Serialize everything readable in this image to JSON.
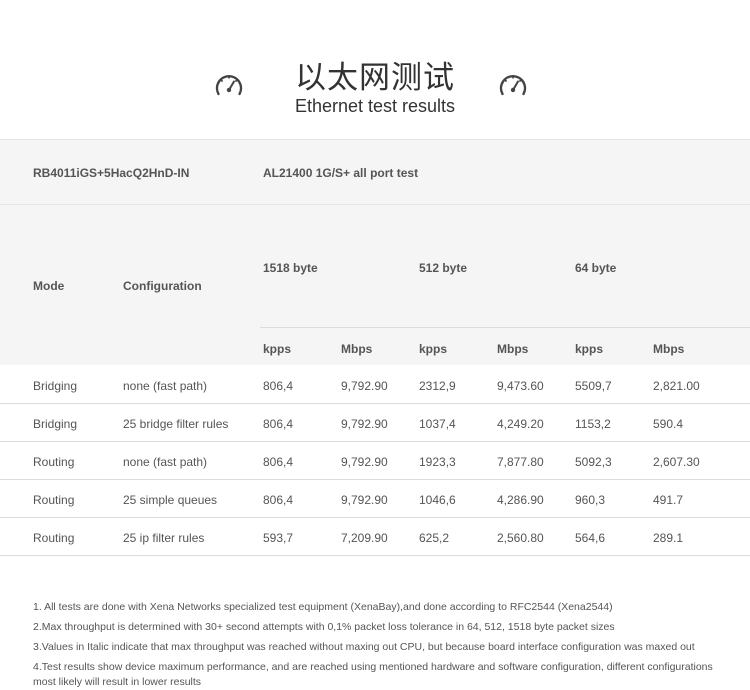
{
  "header": {
    "title_cn": "以太网测试",
    "title_en": "Ethernet test results"
  },
  "table": {
    "device": "RB4011iGS+5HacQ2HnD-IN",
    "test_name": "AL21400 1G/S+ all port test",
    "col_mode": "Mode",
    "col_configuration": "Configuration",
    "packet_sizes": [
      "1518 byte",
      "512 byte",
      "64 byte"
    ],
    "units": [
      "kpps",
      "Mbps",
      "kpps",
      "Mbps",
      "kpps",
      "Mbps"
    ],
    "rows": [
      {
        "mode": "Bridging",
        "config": "none (fast path)",
        "v": [
          "806,4",
          "9,792.90",
          "2312,9",
          "9,473.60",
          "5509,7",
          "2,821.00"
        ]
      },
      {
        "mode": "Bridging",
        "config": "25 bridge filter rules",
        "v": [
          "806,4",
          "9,792.90",
          "1037,4",
          "4,249.20",
          "1153,2",
          "590.4"
        ]
      },
      {
        "mode": "Routing",
        "config": "none (fast path)",
        "v": [
          "806,4",
          "9,792.90",
          "1923,3",
          "7,877.80",
          "5092,3",
          "2,607.30"
        ]
      },
      {
        "mode": "Routing",
        "config": "25 simple queues",
        "v": [
          "806,4",
          "9,792.90",
          "1046,6",
          "4,286.90",
          "960,3",
          "491.7"
        ]
      },
      {
        "mode": "Routing",
        "config": "25 ip filter rules",
        "v": [
          "593,7",
          "7,209.90",
          "625,2",
          "2,560.80",
          "564,6",
          "289.1"
        ]
      }
    ]
  },
  "notes": [
    "1. All tests are done with Xena Networks specialized test equipment (XenaBay),and done according to RFC2544 (Xena2544)",
    "2.Max throughput is determined with 30+ second attempts with 0,1% packet loss tolerance in 64, 512, 1518 byte packet sizes",
    "3.Values in Italic indicate that max throughput was reached without maxing out CPU, but because board interface configuration was maxed out",
    "4.Test results show  device maximum performance, and are reached using mentioned hardware and software configuration, different configurations most likely will result in lower results"
  ]
}
